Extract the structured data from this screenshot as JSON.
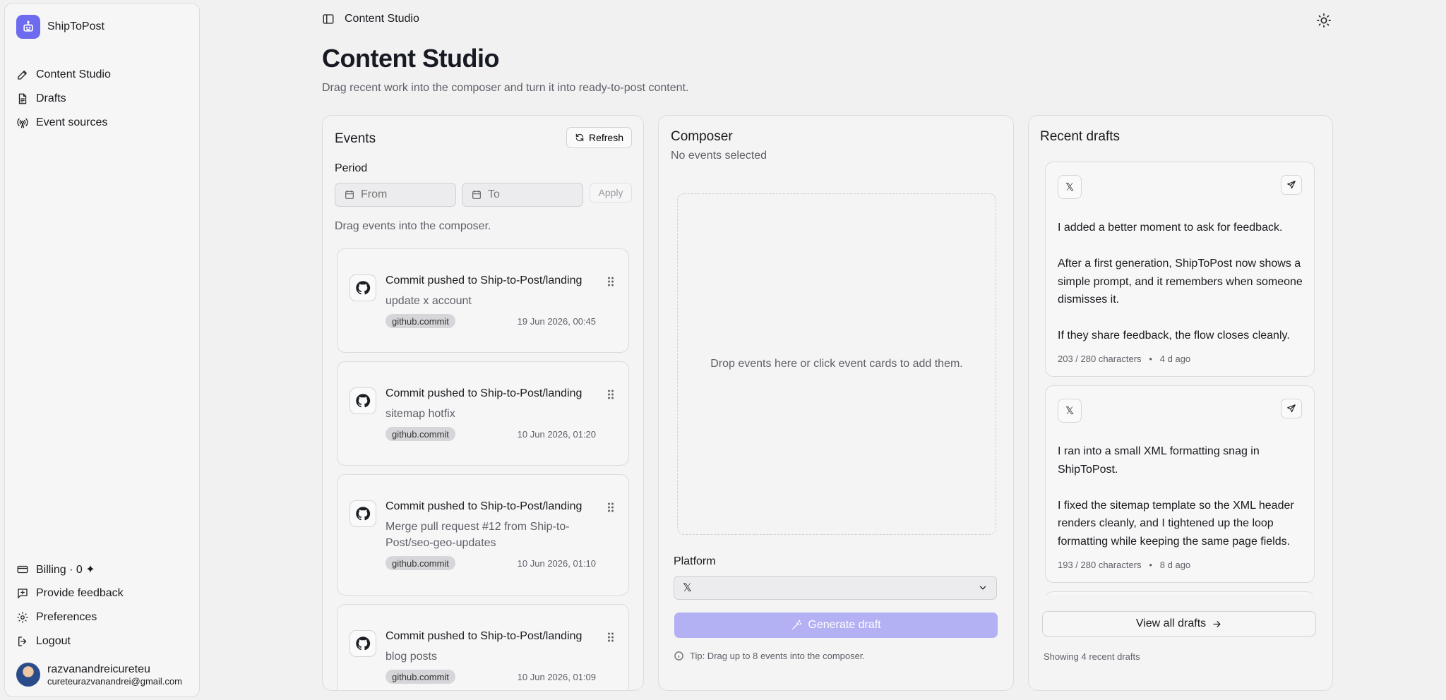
{
  "app": {
    "name": "ShipToPost"
  },
  "sidebar": {
    "nav": [
      {
        "label": "Content Studio",
        "icon": "pencil-icon"
      },
      {
        "label": "Drafts",
        "icon": "document-icon"
      },
      {
        "label": "Event sources",
        "icon": "broadcast-icon"
      }
    ],
    "bottom": [
      {
        "label": "Billing · 0 ✦",
        "icon": "credit-card-icon"
      },
      {
        "label": "Provide feedback",
        "icon": "feedback-icon"
      },
      {
        "label": "Preferences",
        "icon": "gear-icon"
      },
      {
        "label": "Logout",
        "icon": "logout-icon"
      }
    ],
    "user": {
      "name": "razvanandreicureteu",
      "email": "cureteurazvanandrei@gmail.com"
    }
  },
  "header": {
    "breadcrumb": "Content Studio"
  },
  "page": {
    "title": "Content Studio",
    "subtitle": "Drag recent work into the composer and turn it into ready-to-post content."
  },
  "events": {
    "title": "Events",
    "refresh_label": "Refresh",
    "period_label": "Period",
    "from_placeholder": "From",
    "to_placeholder": "To",
    "apply_label": "Apply",
    "hint": "Drag events into the composer.",
    "items": [
      {
        "title": "Commit pushed to Ship-to-Post/landing",
        "subtitle": "update x account",
        "badge": "github.commit",
        "date": "19 Jun 2026, 00:45"
      },
      {
        "title": "Commit pushed to Ship-to-Post/landing",
        "subtitle": "sitemap hotfix",
        "badge": "github.commit",
        "date": "10 Jun 2026, 01:20"
      },
      {
        "title": "Commit pushed to Ship-to-Post/landing",
        "subtitle": "Merge pull request #12 from Ship-to-Post/seo-geo-updates",
        "badge": "github.commit",
        "date": "10 Jun 2026, 01:10"
      },
      {
        "title": "Commit pushed to Ship-to-Post/landing",
        "subtitle": "blog posts",
        "badge": "github.commit",
        "date": "10 Jun 2026, 01:09"
      }
    ]
  },
  "composer": {
    "title": "Composer",
    "status": "No events selected",
    "dropzone_text": "Drop events here or click event cards to add them.",
    "platform_label": "Platform",
    "platform_value": "𝕏",
    "generate_label": "Generate draft",
    "tip": "Tip: Drag up to 8 events into the composer."
  },
  "drafts": {
    "title": "Recent drafts",
    "items": [
      {
        "paragraphs": [
          "I added a better moment to ask for feedback.",
          "After a first generation, ShipToPost now shows a simple prompt, and it remembers when someone dismisses it.",
          "If they share feedback, the flow closes cleanly."
        ],
        "chars": "203 / 280 characters",
        "age": "4 d ago"
      },
      {
        "paragraphs": [
          "I ran into a small XML formatting snag in ShipToPost.",
          "I fixed the sitemap template so the XML header renders cleanly, and I tightened up the loop formatting while keeping the same page fields."
        ],
        "chars": "193 / 280 characters",
        "age": "8 d ago"
      }
    ],
    "view_all_label": "View all drafts",
    "count_text": "Showing 4 recent drafts"
  },
  "colors": {
    "accent": "#6d6bf0",
    "accent_disabled": "#b3b0f4",
    "background": "#f1f1f2"
  }
}
